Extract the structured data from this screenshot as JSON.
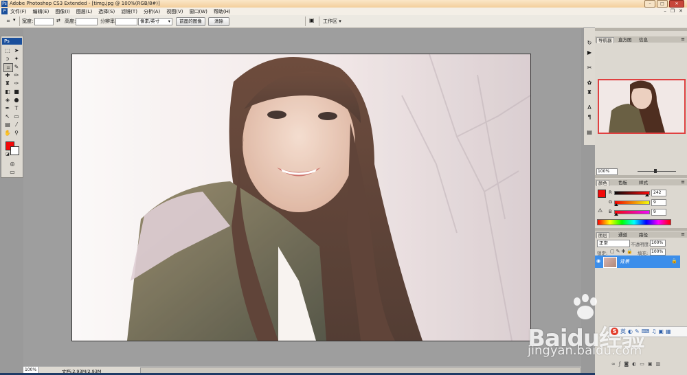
{
  "window": {
    "title": "Adobe Photoshop CS3 Extended - [timg.jpg @ 100%(RGB/8#)]",
    "app_icon": "Ps"
  },
  "menubar": {
    "items": [
      "文件(F)",
      "编辑(E)",
      "图像(I)",
      "图层(L)",
      "选择(S)",
      "滤镜(T)",
      "分析(A)",
      "视图(V)",
      "窗口(W)",
      "帮助(H)"
    ]
  },
  "options_bar": {
    "width_label": "宽度:",
    "height_label": "高度:",
    "resolution_label": "分辨率:",
    "units_value": "像素/英寸",
    "front_image_button": "前面的图像",
    "clear_button": "清除",
    "workspace_label": "工作区 ▾"
  },
  "toolbox": {
    "badge": "Ps",
    "fg_color": "#f20909",
    "bg_color": "#ffffff"
  },
  "status_bar": {
    "zoom": "100%",
    "doc_size": "文档:2.93M/2.93M"
  },
  "navigator": {
    "tabs": [
      "导航器",
      "直方图",
      "信息"
    ],
    "zoom": "100%"
  },
  "color_panel": {
    "tabs": [
      "颜色",
      "色板",
      "样式"
    ],
    "channels": [
      {
        "label": "R",
        "value": "242"
      },
      {
        "label": "G",
        "value": "9"
      },
      {
        "label": "B",
        "value": "9"
      }
    ]
  },
  "layers_panel": {
    "tabs": [
      "图层",
      "通道",
      "路径"
    ],
    "blend_mode": "正常",
    "opacity_label": "不透明度:",
    "opacity_value": "100%",
    "lock_label": "锁定:",
    "fill_label": "填充:",
    "fill_value": "100%",
    "layer_name": "背景"
  },
  "watermark": {
    "brand": "Baidu经验",
    "url": "jingyan.baidu.com"
  },
  "ime_logo": "S"
}
